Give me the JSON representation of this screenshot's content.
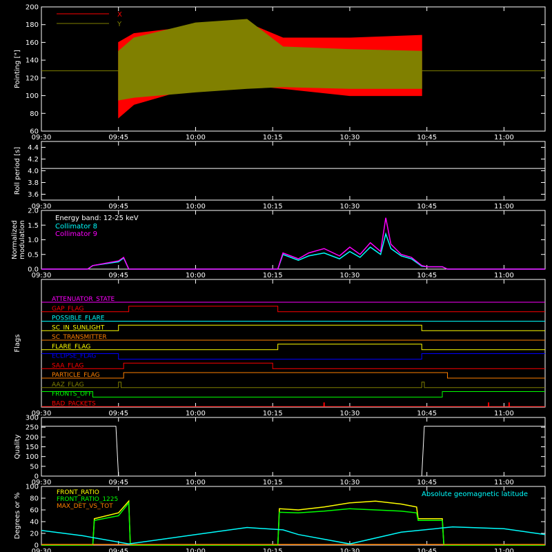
{
  "time_ticks": [
    "09:30",
    "09:45",
    "10:00",
    "10:15",
    "10:30",
    "10:45",
    "11:00"
  ],
  "colors": {
    "background": "#000000",
    "axes": "#ffffff",
    "x": "#ff0000",
    "y": "#808000",
    "cyan": "#00ffff",
    "magenta": "#ff00ff",
    "green": "#00ff00",
    "yellow": "#ffff00",
    "orange": "#ff8000",
    "blue": "#0000ff",
    "red": "#ff0000"
  },
  "chart_data": [
    {
      "type": "area",
      "ylabel": "Pointing [\"]",
      "ylim": [
        60,
        200
      ],
      "yticks": [
        60,
        80,
        100,
        120,
        140,
        160,
        180,
        200
      ],
      "series": [
        {
          "name": "X",
          "color": "#ff0000",
          "x": [
            "09:45",
            "09:48",
            "10:00",
            "10:10",
            "10:17",
            "10:30",
            "10:44"
          ],
          "low": [
            75,
            90,
            110,
            112,
            108,
            100,
            100
          ],
          "high": [
            160,
            170,
            178,
            182,
            165,
            165,
            168
          ]
        },
        {
          "name": "Y",
          "color": "#808000",
          "x": [
            "09:45",
            "09:48",
            "10:00",
            "10:10",
            "10:17",
            "10:30",
            "10:44"
          ],
          "low": [
            95,
            98,
            104,
            108,
            110,
            108,
            108
          ],
          "high": [
            150,
            165,
            182,
            186,
            155,
            152,
            150
          ]
        }
      ],
      "baseline": 128
    },
    {
      "type": "line",
      "ylabel": "Roll period [s]",
      "ylim": [
        3.5,
        4.5
      ],
      "yticks": [
        3.6,
        3.8,
        4.0,
        4.2,
        4.4
      ],
      "series": [
        {
          "color": "#ffffff",
          "x": [
            "09:30",
            "11:08"
          ],
          "y": [
            4.04,
            4.04
          ]
        }
      ]
    },
    {
      "type": "line",
      "ylabel": [
        "Normalized",
        "modulation"
      ],
      "ylim": [
        0,
        2.0
      ],
      "yticks": [
        0.0,
        0.5,
        1.0,
        1.5,
        2.0
      ],
      "annotation": "Energy band: 12-25 keV",
      "series": [
        {
          "name": "Collimator 8",
          "color": "#00ffff",
          "x": [
            "09:30",
            "09:39",
            "09:40",
            "09:45",
            "09:46",
            "09:47",
            "10:16",
            "10:17",
            "10:20",
            "10:22",
            "10:25",
            "10:28",
            "10:30",
            "10:32",
            "10:34",
            "10:36",
            "10:37",
            "10:38",
            "10:40",
            "10:42",
            "10:44",
            "10:45",
            "10:48",
            "10:49",
            "11:08"
          ],
          "y": [
            0,
            0,
            0.12,
            0.25,
            0.38,
            0,
            0,
            0.5,
            0.3,
            0.45,
            0.55,
            0.35,
            0.6,
            0.4,
            0.75,
            0.5,
            1.2,
            0.7,
            0.45,
            0.35,
            0.1,
            0.08,
            0.08,
            0,
            0
          ]
        },
        {
          "name": "Collimator 9",
          "color": "#ff00ff",
          "x": [
            "09:30",
            "09:39",
            "09:40",
            "09:45",
            "09:46",
            "09:47",
            "10:16",
            "10:17",
            "10:20",
            "10:22",
            "10:25",
            "10:28",
            "10:30",
            "10:32",
            "10:34",
            "10:36",
            "10:37",
            "10:38",
            "10:40",
            "10:42",
            "10:44",
            "10:45",
            "10:48",
            "10:49",
            "11:08"
          ],
          "y": [
            0,
            0,
            0.12,
            0.28,
            0.4,
            0,
            0,
            0.55,
            0.35,
            0.55,
            0.7,
            0.45,
            0.75,
            0.5,
            0.9,
            0.6,
            1.75,
            0.85,
            0.5,
            0.4,
            0.12,
            0.08,
            0.08,
            0,
            0
          ]
        }
      ]
    },
    {
      "type": "line",
      "ylabel": "Flags",
      "flags": [
        {
          "name": "ATTENUATOR_STATE",
          "color": "#ff00ff",
          "steps": [
            [
              "09:30",
              0
            ],
            [
              "11:08",
              0
            ]
          ]
        },
        {
          "name": "GAP_FLAG",
          "color": "#ff0000",
          "steps": [
            [
              "09:30",
              0
            ],
            [
              "09:47",
              1
            ],
            [
              "10:16",
              0
            ],
            [
              "11:08",
              0
            ]
          ]
        },
        {
          "name": "POSSIBLE_FLARE",
          "color": "#00ffff",
          "steps": [
            [
              "09:30",
              0
            ],
            [
              "11:08",
              0
            ]
          ]
        },
        {
          "name": "SC_IN_SUNLIGHT",
          "color": "#ffff00",
          "steps": [
            [
              "09:30",
              0
            ],
            [
              "09:45",
              1
            ],
            [
              "10:44",
              0
            ],
            [
              "11:08",
              0
            ]
          ]
        },
        {
          "name": "SC_TRANSMITTER",
          "color": "#ff8000",
          "steps": [
            [
              "09:30",
              0
            ],
            [
              "11:08",
              0
            ]
          ]
        },
        {
          "name": "FLARE_FLAG",
          "color": "#ffff00",
          "steps": [
            [
              "09:30",
              0
            ],
            [
              "10:16",
              1
            ],
            [
              "10:44",
              0
            ],
            [
              "11:08",
              0
            ]
          ]
        },
        {
          "name": "ECLIPSE_FLAG",
          "color": "#0000ff",
          "steps": [
            [
              "09:30",
              1
            ],
            [
              "09:45",
              0
            ],
            [
              "10:44",
              1
            ],
            [
              "11:08",
              1
            ]
          ]
        },
        {
          "name": "SAA_FLAG",
          "color": "#ff0000",
          "steps": [
            [
              "09:30",
              0
            ],
            [
              "09:46",
              1
            ],
            [
              "10:15",
              0
            ],
            [
              "11:08",
              0
            ]
          ]
        },
        {
          "name": "PARTICLE_FLAG",
          "color": "#ff8000",
          "steps": [
            [
              "09:30",
              0
            ],
            [
              "09:46",
              1
            ],
            [
              "10:49",
              0
            ],
            [
              "11:08",
              0
            ]
          ]
        },
        {
          "name": "AAZ_FLAG",
          "color": "#808000",
          "steps": [
            [
              "09:30",
              0
            ],
            [
              "09:45",
              1
            ],
            [
              "09:45.5",
              0
            ],
            [
              "10:44",
              1
            ],
            [
              "10:44.5",
              0
            ],
            [
              "11:08",
              0
            ]
          ]
        },
        {
          "name": "FRONTS_OFF",
          "color": "#00ff00",
          "steps": [
            [
              "09:30",
              1
            ],
            [
              "09:40",
              0
            ],
            [
              "10:48",
              1
            ],
            [
              "11:08",
              1
            ]
          ]
        },
        {
          "name": "BAD_PACKETS",
          "color": "#ff0000",
          "steps": [
            [
              "09:30",
              0
            ],
            [
              "11:08",
              0
            ]
          ],
          "spikes": [
            "10:25",
            "10:57",
            "11:01"
          ]
        }
      ]
    },
    {
      "type": "line",
      "ylabel": "Quality",
      "ylim": [
        0,
        300
      ],
      "yticks": [
        0,
        50,
        100,
        150,
        200,
        250,
        300
      ],
      "series": [
        {
          "color": "#ffffff",
          "x": [
            "09:30",
            "09:44.5",
            "09:45",
            "10:44",
            "10:44.5",
            "11:08"
          ],
          "y": [
            255,
            255,
            0,
            0,
            255,
            255
          ]
        }
      ]
    },
    {
      "type": "line",
      "ylabel": "Degrees or %",
      "ylim": [
        0,
        100
      ],
      "yticks": [
        0,
        20,
        40,
        60,
        80,
        100
      ],
      "annotation": "Absolute geomagnetic latitude",
      "series": [
        {
          "name": "FRONT_RATIO",
          "color": "#ffff00",
          "x": [
            "09:30",
            "09:40",
            "09:40.3",
            "09:45",
            "09:47",
            "09:47.3",
            "10:16",
            "10:16.3",
            "10:20",
            "10:25",
            "10:30",
            "10:35",
            "10:40",
            "10:43",
            "10:43.3",
            "10:48",
            "10:48.3",
            "11:08"
          ],
          "y": [
            0,
            0,
            45,
            55,
            75,
            0,
            0,
            62,
            60,
            65,
            72,
            75,
            70,
            65,
            45,
            45,
            0,
            0
          ]
        },
        {
          "name": "FRONT_RATIO_1225",
          "color": "#00ff00",
          "x": [
            "09:30",
            "09:40",
            "09:40.3",
            "09:45",
            "09:47",
            "09:47.3",
            "10:16",
            "10:16.3",
            "10:20",
            "10:25",
            "10:30",
            "10:35",
            "10:40",
            "10:43",
            "10:43.3",
            "10:48",
            "10:48.3",
            "11:08"
          ],
          "y": [
            0,
            0,
            42,
            50,
            72,
            0,
            0,
            56,
            55,
            58,
            62,
            60,
            58,
            55,
            42,
            42,
            0,
            0
          ]
        },
        {
          "name": "MAX_DET_VS_TOT",
          "color": "#ff8000",
          "x": [
            "09:30",
            "11:08"
          ],
          "y": [
            1,
            1
          ]
        },
        {
          "color": "#00ffff",
          "x": [
            "09:30",
            "09:38",
            "09:47",
            "10:00",
            "10:10",
            "10:17",
            "10:20",
            "10:30",
            "10:40",
            "10:50",
            "11:00",
            "11:08"
          ],
          "y": [
            25,
            16,
            2,
            18,
            30,
            26,
            18,
            2,
            22,
            31,
            28,
            18
          ]
        }
      ]
    }
  ]
}
